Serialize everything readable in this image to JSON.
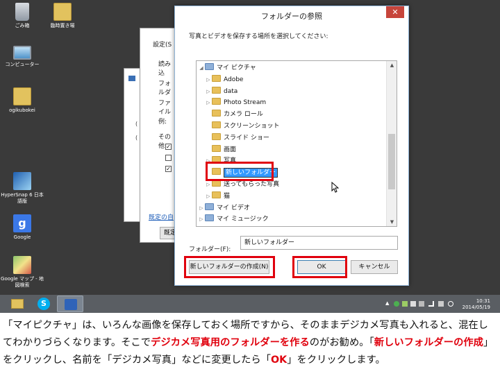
{
  "desktop": {
    "icons": [
      {
        "label": "ごみ箱",
        "icon": "recycle-bin-icon"
      },
      {
        "label": "臨時置き場",
        "icon": "folder-icon"
      },
      {
        "label": "コンピューター",
        "icon": "computer-icon"
      },
      {
        "label": "ogikubokei",
        "icon": "user-folder-icon"
      },
      {
        "label": "HyperSnap 6 日本語版",
        "icon": "hypersnap-icon"
      },
      {
        "label": "Google",
        "icon": "google-icon"
      },
      {
        "label": "Google マップ - 地図検索",
        "icon": "google-maps-icon"
      }
    ]
  },
  "background_window": {
    "settings_label": "設定(S",
    "items": [
      "読み込",
      "フォルダ",
      "ファイル",
      "例:",
      "その他"
    ],
    "link": "既定の自",
    "button": "既定"
  },
  "dialog": {
    "title": "フォルダーの参照",
    "prompt": "写真とビデオを保存する場所を選択してください:",
    "tree": [
      {
        "label": "マイ ピクチャ",
        "indent": 1,
        "arrow": "◢",
        "media": true
      },
      {
        "label": "Adobe",
        "indent": 2,
        "arrow": "▷",
        "media": false
      },
      {
        "label": "data",
        "indent": 2,
        "arrow": "▷",
        "media": false
      },
      {
        "label": "Photo Stream",
        "indent": 2,
        "arrow": "▷",
        "media": false
      },
      {
        "label": "カメラ ロール",
        "indent": 2,
        "arrow": "",
        "media": false
      },
      {
        "label": "スクリーンショット",
        "indent": 2,
        "arrow": "",
        "media": false
      },
      {
        "label": "スライド ショー",
        "indent": 2,
        "arrow": "",
        "media": false
      },
      {
        "label": "画面",
        "indent": 2,
        "arrow": "",
        "media": false
      },
      {
        "label": "写真",
        "indent": 2,
        "arrow": "▷",
        "media": false
      },
      {
        "label": "新しいフォルダー",
        "indent": 2,
        "arrow": "",
        "media": false,
        "editing": true
      },
      {
        "label": "送ってもらった写真",
        "indent": 2,
        "arrow": "▷",
        "media": false
      },
      {
        "label": "猫",
        "indent": 2,
        "arrow": "▷",
        "media": false
      },
      {
        "label": "マイ ビデオ",
        "indent": 1,
        "arrow": "▷",
        "media": true
      },
      {
        "label": "マイ ミュージック",
        "indent": 1,
        "arrow": "▷",
        "media": true
      }
    ],
    "folder_label": "フォルダー(F):",
    "folder_value": "新しいフォルダー",
    "new_folder_button": "新しいフォルダーの作成(N)",
    "ok_button": "OK",
    "cancel_button": "キャンセル"
  },
  "taskbar": {
    "time": "10:31",
    "date": "2014/05/19"
  },
  "caption": {
    "part1": "「マイピクチャ」は、いろんな画像を保存しておく場所ですから、そのままデジカメ写真も入れると、混在してわかりづらくなります。そこで",
    "red1": "デジカメ写真用のフォルダーを作る",
    "part2": "のがお勧め。「",
    "red2": "新しいフォルダーの作成",
    "part3": "」をクリックし、名前を「デジカメ写真」などに変更したら「",
    "red3": "OK",
    "part4": "」をクリックします。"
  },
  "colors": {
    "highlight_red": "#e0000d",
    "close_red": "#c7453b",
    "desktop": "#3a3a3a"
  }
}
